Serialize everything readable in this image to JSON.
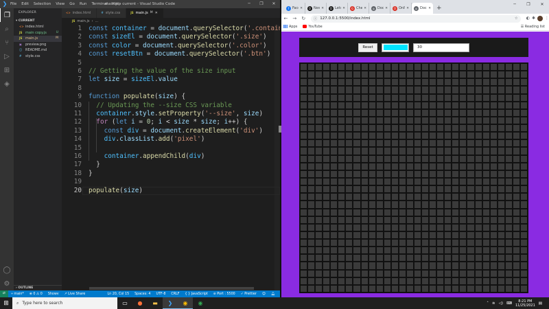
{
  "vscode": {
    "window_title": "main.js - current - Visual Studio Code",
    "menu": [
      "File",
      "Edit",
      "Selection",
      "View",
      "Go",
      "Run",
      "Terminal",
      "Help"
    ],
    "explorer": {
      "header": "EXPLORER",
      "section": "CURRENT",
      "files": [
        {
          "name": "index.html",
          "icon": "<>",
          "icon_color": "#e37933",
          "status": "",
          "color": "#cccccc"
        },
        {
          "name": "main copy.js",
          "icon": "JS",
          "icon_color": "#cbcb41",
          "status": "U",
          "color": "#73c991"
        },
        {
          "name": "main.js",
          "icon": "JS",
          "icon_color": "#cbcb41",
          "status": "M",
          "color": "#e2c08d"
        },
        {
          "name": "preview.png",
          "icon": "▣",
          "icon_color": "#a074c4",
          "status": "",
          "color": "#cccccc"
        },
        {
          "name": "README.md",
          "icon": "ⓘ",
          "icon_color": "#519aba",
          "status": "",
          "color": "#cccccc"
        },
        {
          "name": "style.css",
          "icon": "#",
          "icon_color": "#519aba",
          "status": "",
          "color": "#cccccc"
        }
      ],
      "outline": "OUTLINE"
    },
    "tabs": [
      {
        "name": "index.html",
        "icon": "<>",
        "icon_color": "#e37933",
        "status": "",
        "active": false
      },
      {
        "name": "style.css",
        "icon": "#",
        "icon_color": "#519aba",
        "status": "",
        "active": false
      },
      {
        "name": "main.js",
        "icon": "JS",
        "icon_color": "#cbcb41",
        "status": "M",
        "active": true
      }
    ],
    "breadcrumb": [
      "JS",
      "main.js",
      "..."
    ],
    "code_lines": [
      {
        "n": "1",
        "tokens": [
          [
            "k",
            "const "
          ],
          [
            "c",
            "container"
          ],
          [
            "p",
            " = "
          ],
          [
            "v",
            "document"
          ],
          [
            "p",
            "."
          ],
          [
            "f",
            "querySelector"
          ],
          [
            "p",
            "("
          ],
          [
            "s",
            "'.contain"
          ]
        ]
      },
      {
        "n": "2",
        "tokens": [
          [
            "k",
            "const "
          ],
          [
            "c",
            "sizeEl"
          ],
          [
            "p",
            " = "
          ],
          [
            "v",
            "document"
          ],
          [
            "p",
            "."
          ],
          [
            "f",
            "querySelector"
          ],
          [
            "p",
            "("
          ],
          [
            "s",
            "'.size'"
          ],
          [
            "p",
            ")"
          ]
        ]
      },
      {
        "n": "3",
        "tokens": [
          [
            "k",
            "const "
          ],
          [
            "c",
            "color"
          ],
          [
            "p",
            " = "
          ],
          [
            "v",
            "document"
          ],
          [
            "p",
            "."
          ],
          [
            "f",
            "querySelector"
          ],
          [
            "p",
            "("
          ],
          [
            "s",
            "'.color'"
          ],
          [
            "p",
            ")"
          ]
        ]
      },
      {
        "n": "4",
        "tokens": [
          [
            "k",
            "const "
          ],
          [
            "c",
            "resetBtn"
          ],
          [
            "p",
            " = "
          ],
          [
            "v",
            "document"
          ],
          [
            "p",
            "."
          ],
          [
            "f",
            "querySelector"
          ],
          [
            "p",
            "("
          ],
          [
            "s",
            "'.btn'"
          ],
          [
            "p",
            ")"
          ]
        ]
      },
      {
        "n": "5",
        "tokens": []
      },
      {
        "n": "6",
        "tokens": [
          [
            "cm",
            "// Getting the value of the size input"
          ]
        ]
      },
      {
        "n": "7",
        "tokens": [
          [
            "k",
            "let "
          ],
          [
            "v",
            "size"
          ],
          [
            "p",
            " = "
          ],
          [
            "c",
            "sizeEl"
          ],
          [
            "p",
            "."
          ],
          [
            "v",
            "value"
          ]
        ]
      },
      {
        "n": "8",
        "tokens": []
      },
      {
        "n": "9",
        "tokens": [
          [
            "k",
            "function "
          ],
          [
            "f",
            "populate"
          ],
          [
            "p",
            "("
          ],
          [
            "v",
            "size"
          ],
          [
            "p",
            ") {"
          ]
        ]
      },
      {
        "n": "10",
        "tokens": [
          [
            "p",
            "  "
          ],
          [
            "cm",
            "// Updating the --size CSS variable"
          ]
        ]
      },
      {
        "n": "11",
        "tokens": [
          [
            "p",
            "  "
          ],
          [
            "c",
            "container"
          ],
          [
            "p",
            "."
          ],
          [
            "v",
            "style"
          ],
          [
            "p",
            "."
          ],
          [
            "f",
            "setProperty"
          ],
          [
            "p",
            "("
          ],
          [
            "s",
            "'--size'"
          ],
          [
            "p",
            ", "
          ],
          [
            "v",
            "size"
          ],
          [
            "p",
            ")"
          ]
        ]
      },
      {
        "n": "12",
        "tokens": [
          [
            "p",
            "  "
          ],
          [
            "kf",
            "for"
          ],
          [
            "p",
            " ("
          ],
          [
            "k",
            "let "
          ],
          [
            "v",
            "i"
          ],
          [
            "p",
            " = "
          ],
          [
            "n",
            "0"
          ],
          [
            "p",
            "; "
          ],
          [
            "v",
            "i"
          ],
          [
            "p",
            " < "
          ],
          [
            "v",
            "size"
          ],
          [
            "p",
            " * "
          ],
          [
            "v",
            "size"
          ],
          [
            "p",
            "; "
          ],
          [
            "v",
            "i"
          ],
          [
            "p",
            "++) {"
          ]
        ]
      },
      {
        "n": "13",
        "tokens": [
          [
            "p",
            "    "
          ],
          [
            "k",
            "const "
          ],
          [
            "c",
            "div"
          ],
          [
            "p",
            " = "
          ],
          [
            "v",
            "document"
          ],
          [
            "p",
            "."
          ],
          [
            "f",
            "createElement"
          ],
          [
            "p",
            "("
          ],
          [
            "s",
            "'div'"
          ],
          [
            "p",
            ")"
          ]
        ]
      },
      {
        "n": "14",
        "tokens": [
          [
            "p",
            "    "
          ],
          [
            "c",
            "div"
          ],
          [
            "p",
            "."
          ],
          [
            "v",
            "classList"
          ],
          [
            "p",
            "."
          ],
          [
            "f",
            "add"
          ],
          [
            "p",
            "("
          ],
          [
            "s",
            "'pixel'"
          ],
          [
            "p",
            ")"
          ]
        ]
      },
      {
        "n": "15",
        "tokens": []
      },
      {
        "n": "16",
        "tokens": [
          [
            "p",
            "    "
          ],
          [
            "c",
            "container"
          ],
          [
            "p",
            "."
          ],
          [
            "f",
            "appendChild"
          ],
          [
            "p",
            "("
          ],
          [
            "c",
            "div"
          ],
          [
            "p",
            ")"
          ]
        ]
      },
      {
        "n": "17",
        "tokens": [
          [
            "p",
            "  }"
          ]
        ]
      },
      {
        "n": "18",
        "tokens": [
          [
            "p",
            "}"
          ]
        ]
      },
      {
        "n": "19",
        "tokens": []
      },
      {
        "n": "20",
        "tokens": [
          [
            "f",
            "populate"
          ],
          [
            "p",
            "("
          ],
          [
            "v",
            "size"
          ],
          [
            "p",
            ")"
          ]
        ]
      }
    ],
    "current_line": "20",
    "status": {
      "branch": "main*",
      "errors": "0",
      "warnings": "0",
      "show": "Showv",
      "live_share": "Live Share",
      "position": "Ln 20, Col 15",
      "spaces": "Spaces: 4",
      "encoding": "UTF-8",
      "eol": "CRLF",
      "language": "JavaScript",
      "port": "Port : 5500",
      "prettier": "Prettier"
    }
  },
  "chrome": {
    "tabs": [
      {
        "label": "Faceb",
        "fav_color": "#1877f2",
        "fav": "f",
        "active": false
      },
      {
        "label": "New",
        "fav_color": "#111111",
        "fav": "D",
        "active": false
      },
      {
        "label": "Lets",
        "fav_color": "#111111",
        "fav": "D",
        "active": false
      },
      {
        "label": "Chec",
        "fav_color": "#d93025",
        "fav": "G",
        "active": false
      },
      {
        "label": "Docu",
        "fav_color": "#5f6368",
        "fav": "◎",
        "active": false
      },
      {
        "label": "OnPo",
        "fav_color": "#d93025",
        "fav": "O",
        "active": false
      },
      {
        "label": "Docu",
        "fav_color": "#5f6368",
        "fav": "◎",
        "active": true
      }
    ],
    "url": "127.0.0.1:5500/index.html",
    "bookmarks": [
      "Apps",
      "YouTube"
    ],
    "reading_list": "Reading list"
  },
  "app": {
    "reset_label": "Reset",
    "color_value": "#00e5ff",
    "size_value": "30",
    "grid_size": 30
  },
  "taskbar": {
    "search_placeholder": "Type here to search",
    "time": "8:21 PM",
    "date": "11/25/2021"
  }
}
